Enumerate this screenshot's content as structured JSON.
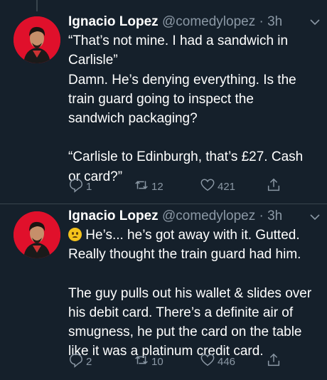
{
  "tweets": [
    {
      "name": "Ignacio Lopez",
      "handle": "@comedylopez",
      "time": "· 3h",
      "lines": [
        "“That’s not mine. I had a sandwich in",
        "Carlisle”",
        "Damn. He’s denying everything. Is the",
        "train guard going to inspect the",
        "sandwich packaging?",
        "",
        "“Carlisle to Edinburgh, that’s £27. Cash",
        "or card?”"
      ],
      "replies": "1",
      "retweets": "12",
      "likes": "421"
    },
    {
      "name": "Ignacio Lopez",
      "handle": "@comedylopez",
      "time": "· 3h",
      "lines": [
        " He’s... he’s got away with it. Gutted.",
        "Really thought the train guard had him.",
        "",
        "The guy pulls out his wallet & slides over",
        "his debit card. There’s a definite air of",
        "smugness, he put the card on the table",
        "like it was a platinum credit card."
      ],
      "replies": "2",
      "retweets": "10",
      "likes": "446"
    }
  ],
  "icons": {
    "avatar_bg": "#e0102b",
    "emoji": "worried-face"
  }
}
